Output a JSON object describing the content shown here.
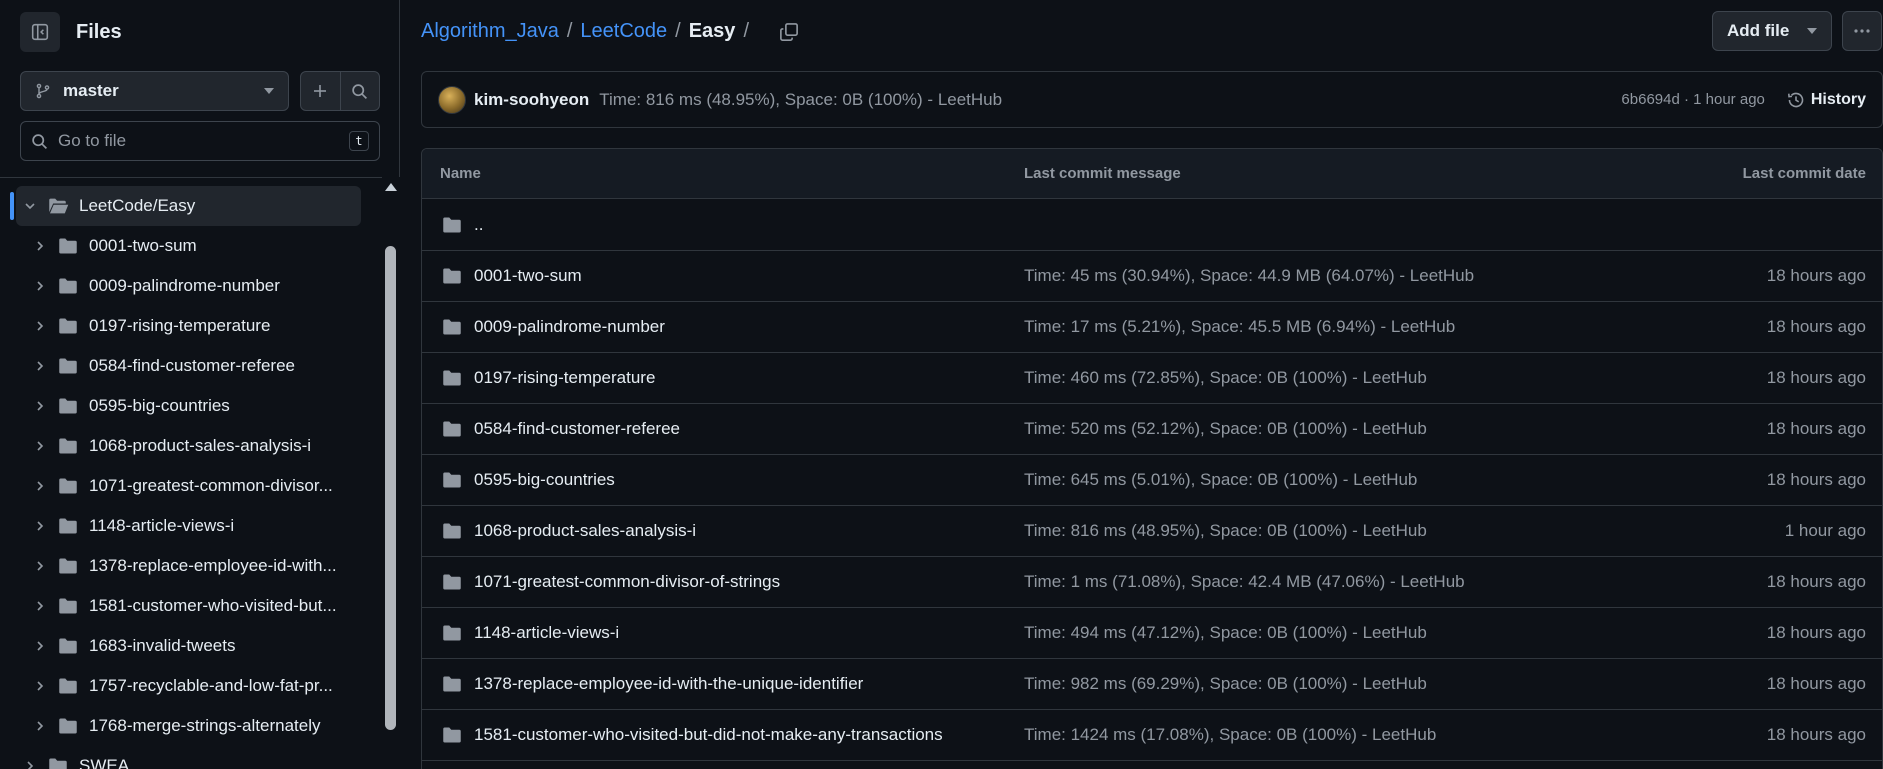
{
  "colors": {
    "background": "#0d1117",
    "border": "#30363d",
    "accent_link": "#4493f8",
    "muted_text": "#9198a1",
    "text": "#e6edf3",
    "button_bg": "#21262d",
    "header_bg": "#151b23"
  },
  "sidebar": {
    "title": "Files",
    "toggle_icon": "sidebar-collapse-icon",
    "branch": {
      "label": "master",
      "icon": "git-branch-icon"
    },
    "add_icon": "plus-icon",
    "search_icon": "search-icon",
    "goto": {
      "placeholder": "Go to file",
      "shortcut": "t"
    },
    "tree": [
      {
        "label": "LeetCode/Easy",
        "level": 0,
        "expanded": true,
        "active": true
      },
      {
        "label": "0001-two-sum",
        "level": 1
      },
      {
        "label": "0009-palindrome-number",
        "level": 1
      },
      {
        "label": "0197-rising-temperature",
        "level": 1
      },
      {
        "label": "0584-find-customer-referee",
        "level": 1
      },
      {
        "label": "0595-big-countries",
        "level": 1
      },
      {
        "label": "1068-product-sales-analysis-i",
        "level": 1
      },
      {
        "label": "1071-greatest-common-divisor...",
        "level": 1
      },
      {
        "label": "1148-article-views-i",
        "level": 1
      },
      {
        "label": "1378-replace-employee-id-with...",
        "level": 1
      },
      {
        "label": "1581-customer-who-visited-but...",
        "level": 1
      },
      {
        "label": "1683-invalid-tweets",
        "level": 1
      },
      {
        "label": "1757-recyclable-and-low-fat-pr...",
        "level": 1
      },
      {
        "label": "1768-merge-strings-alternately",
        "level": 1
      },
      {
        "label": "SWEA",
        "level": 0,
        "expanded": false
      }
    ]
  },
  "breadcrumb": {
    "repo": "Algorithm_Java",
    "folder": "LeetCode",
    "current": "Easy",
    "separator": "/"
  },
  "header_actions": {
    "add_file_label": "Add file",
    "more_icon": "kebab-horizontal-icon"
  },
  "latest_commit": {
    "author": "kim-soohyeon",
    "message": "Time: 816 ms (48.95%), Space: 0B (100%) - LeetHub",
    "sha_time": "6b6694d · 1 hour ago",
    "history_label": "History"
  },
  "table": {
    "columns": {
      "name": "Name",
      "message": "Last commit message",
      "date": "Last commit date"
    },
    "parent_label": "..",
    "rows": [
      {
        "name": "0001-two-sum",
        "message": "Time: 45 ms (30.94%), Space: 44.9 MB (64.07%) - LeetHub",
        "date": "18 hours ago"
      },
      {
        "name": "0009-palindrome-number",
        "message": "Time: 17 ms (5.21%), Space: 45.5 MB (6.94%) - LeetHub",
        "date": "18 hours ago"
      },
      {
        "name": "0197-rising-temperature",
        "message": "Time: 460 ms (72.85%), Space: 0B (100%) - LeetHub",
        "date": "18 hours ago"
      },
      {
        "name": "0584-find-customer-referee",
        "message": "Time: 520 ms (52.12%), Space: 0B (100%) - LeetHub",
        "date": "18 hours ago"
      },
      {
        "name": "0595-big-countries",
        "message": "Time: 645 ms (5.01%), Space: 0B (100%) - LeetHub",
        "date": "18 hours ago"
      },
      {
        "name": "1068-product-sales-analysis-i",
        "message": "Time: 816 ms (48.95%), Space: 0B (100%) - LeetHub",
        "date": "1 hour ago"
      },
      {
        "name": "1071-greatest-common-divisor-of-strings",
        "message": "Time: 1 ms (71.08%), Space: 42.4 MB (47.06%) - LeetHub",
        "date": "18 hours ago"
      },
      {
        "name": "1148-article-views-i",
        "message": "Time: 494 ms (47.12%), Space: 0B (100%) - LeetHub",
        "date": "18 hours ago"
      },
      {
        "name": "1378-replace-employee-id-with-the-unique-identifier",
        "message": "Time: 982 ms (69.29%), Space: 0B (100%) - LeetHub",
        "date": "18 hours ago"
      },
      {
        "name": "1581-customer-who-visited-but-did-not-make-any-transactions",
        "message": "Time: 1424 ms (17.08%), Space: 0B (100%) - LeetHub",
        "date": "18 hours ago"
      }
    ]
  }
}
